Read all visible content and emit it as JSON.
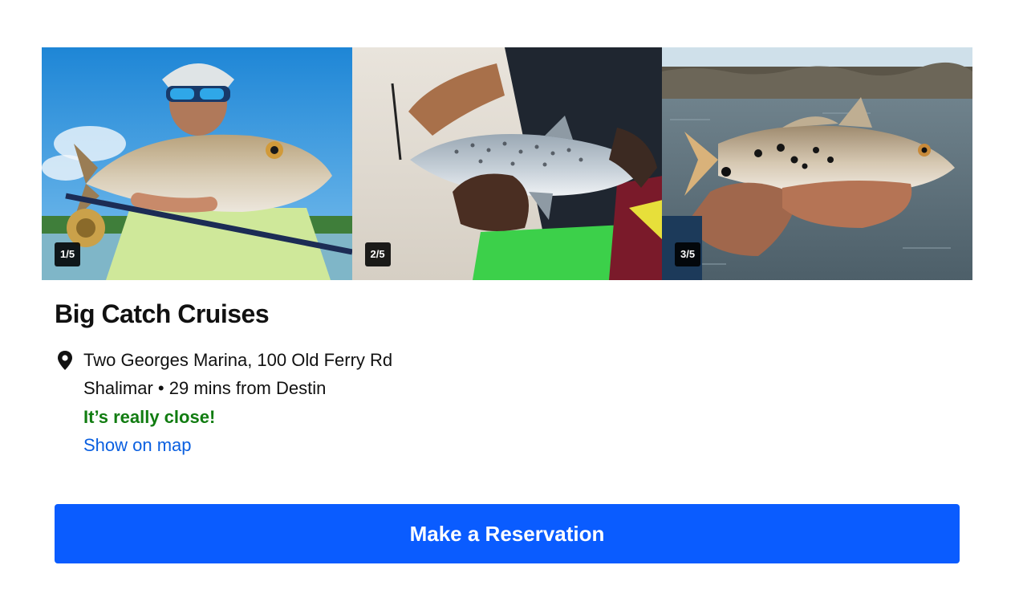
{
  "gallery": {
    "photos": [
      {
        "counter": "1/5",
        "subject": "redfish"
      },
      {
        "counter": "2/5",
        "subject": "spotted-seatrout"
      },
      {
        "counter": "3/5",
        "subject": "redfish"
      }
    ]
  },
  "listing": {
    "title": "Big Catch Cruises",
    "address_line1": "Two Georges Marina, 100 Old Ferry Rd",
    "address_line2": "Shalimar • 29 mins from Destin",
    "proximity_note": "It’s really close!",
    "map_link": "Show on map",
    "location_icon": "map-pin-icon"
  },
  "cta": {
    "label": "Make a Reservation"
  },
  "colors": {
    "accent": "#0a5cff",
    "link": "#0a5fe0",
    "proximity": "#117c11"
  }
}
